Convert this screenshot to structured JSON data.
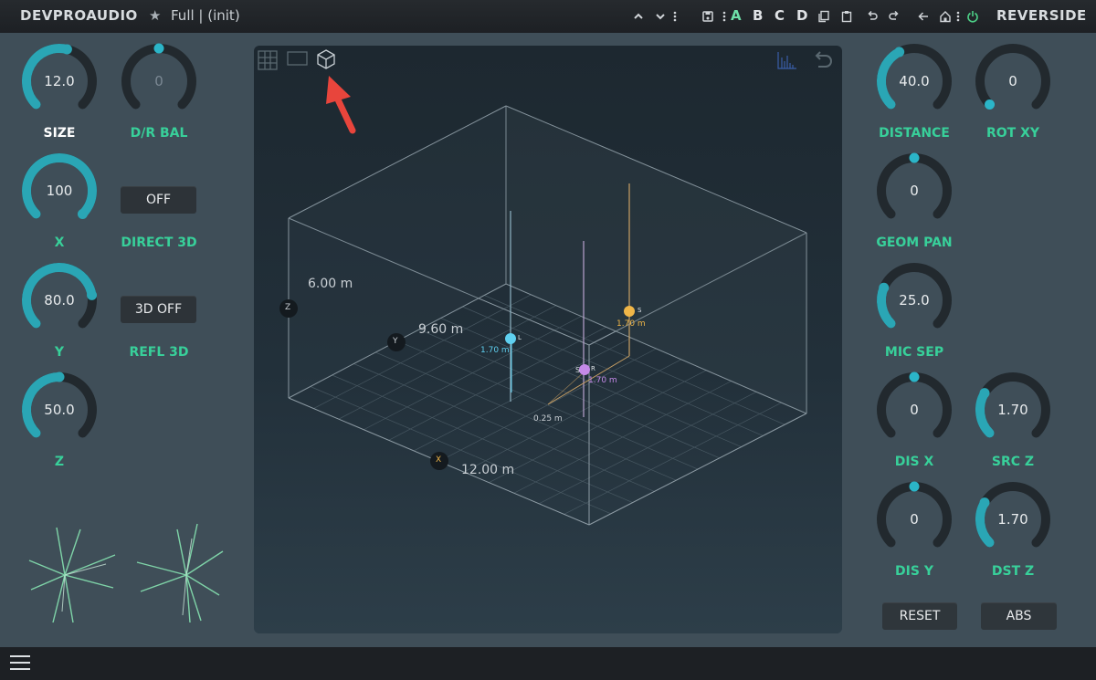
{
  "brand": "DEVPROAUDIO",
  "preset": "Full | (init)",
  "product": "REVERSIDE",
  "abc": [
    "A",
    "B",
    "C",
    "D"
  ],
  "left": {
    "size": {
      "value": "12.0",
      "label": "SIZE"
    },
    "dr_bal": {
      "value": "0",
      "label": "D/R BAL"
    },
    "x": {
      "value": "100",
      "label": "X"
    },
    "direct3d": {
      "button": "OFF",
      "label": "DIRECT 3D"
    },
    "y": {
      "value": "80.0",
      "label": "Y"
    },
    "refl3d": {
      "button": "3D OFF",
      "label": "REFL 3D"
    },
    "z": {
      "value": "50.0",
      "label": "Z"
    }
  },
  "right": {
    "distance": {
      "value": "40.0",
      "label": "DISTANCE"
    },
    "rot_xy": {
      "value": "0",
      "label": "ROT XY"
    },
    "geom_pan": {
      "value": "0",
      "label": "GEOM PAN"
    },
    "mic_sep": {
      "value": "25.0",
      "label": "MIC SEP"
    },
    "dis_x": {
      "value": "0",
      "label": "DIS X"
    },
    "src_z": {
      "value": "1.70",
      "label": "SRC Z"
    },
    "dis_y": {
      "value": "0",
      "label": "DIS Y"
    },
    "dst_z": {
      "value": "1.70",
      "label": "DST Z"
    },
    "reset": "RESET",
    "abs": "ABS"
  },
  "view": {
    "height_label": "6.00 m",
    "depth_label": "9.60 m",
    "width_label": "12.00 m",
    "axis_z": "Z",
    "axis_y": "Y",
    "axis_x": "X",
    "mic_l_label": "L",
    "mic_l_height": "1.70 m",
    "source_label": "S",
    "source_height": "1.70 m",
    "mic_r_label": "R",
    "mic_r_height": "1.70 m",
    "mic_r_extra": "S",
    "sep_label": "0.25 m"
  },
  "colors": {
    "accent": "#2aa6b5",
    "label_green": "#38d09a",
    "mic_l": "#5fd0f0",
    "source": "#f0b648",
    "mic_r": "#c58ae8",
    "arrow": "#e8453c"
  }
}
